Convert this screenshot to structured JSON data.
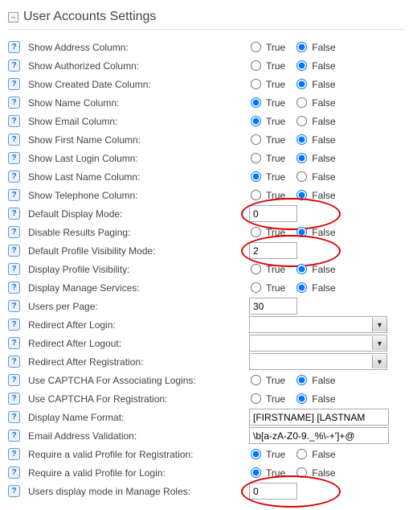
{
  "section_title": "User Accounts Settings",
  "true_label": "True",
  "false_label": "False",
  "rows": [
    {
      "label": "Show Address Column:",
      "type": "radio",
      "value": "false"
    },
    {
      "label": "Show Authorized Column:",
      "type": "radio",
      "value": "false"
    },
    {
      "label": "Show Created Date Column:",
      "type": "radio",
      "value": "false"
    },
    {
      "label": "Show Name Column:",
      "type": "radio",
      "value": "true"
    },
    {
      "label": "Show Email Column:",
      "type": "radio",
      "value": "true"
    },
    {
      "label": "Show First Name Column:",
      "type": "radio",
      "value": "false"
    },
    {
      "label": "Show Last Login Column:",
      "type": "radio",
      "value": "false"
    },
    {
      "label": "Show Last Name Column:",
      "type": "radio",
      "value": "true"
    },
    {
      "label": "Show Telephone Column:",
      "type": "radio",
      "value": "false"
    },
    {
      "label": "Default Display Mode:",
      "type": "text",
      "value": "0",
      "annot": true
    },
    {
      "label": "Disable Results Paging:",
      "type": "radio",
      "value": "false"
    },
    {
      "label": "Default Profile Visibility Mode:",
      "type": "text",
      "value": "2",
      "annot": true
    },
    {
      "label": "Display Profile Visibility:",
      "type": "radio",
      "value": "false"
    },
    {
      "label": "Display Manage Services:",
      "type": "radio",
      "value": "false"
    },
    {
      "label": "Users per Page:",
      "type": "text",
      "value": "30"
    },
    {
      "label": "Redirect After Login:",
      "type": "select",
      "value": ""
    },
    {
      "label": "Redirect After Logout:",
      "type": "select",
      "value": ""
    },
    {
      "label": "Redirect After Registration:",
      "type": "select",
      "value": ""
    },
    {
      "label": "Use CAPTCHA For Associating Logins:",
      "type": "radio",
      "value": "false"
    },
    {
      "label": "Use CAPTCHA For Registration:",
      "type": "radio",
      "value": "false"
    },
    {
      "label": "Display Name Format:",
      "type": "textwide",
      "value": "[FIRSTNAME] [LASTNAM"
    },
    {
      "label": "Email Address Validation:",
      "type": "textwide",
      "value": "\\b[a-zA-Z0-9._%\\-+']+@"
    },
    {
      "label": "Require a valid Profile for Registration:",
      "type": "radio",
      "value": "true"
    },
    {
      "label": "Require a valid Profile for Login:",
      "type": "radio",
      "value": "true"
    },
    {
      "label": "Users display mode in Manage Roles:",
      "type": "text",
      "value": "0",
      "annot": true
    }
  ]
}
